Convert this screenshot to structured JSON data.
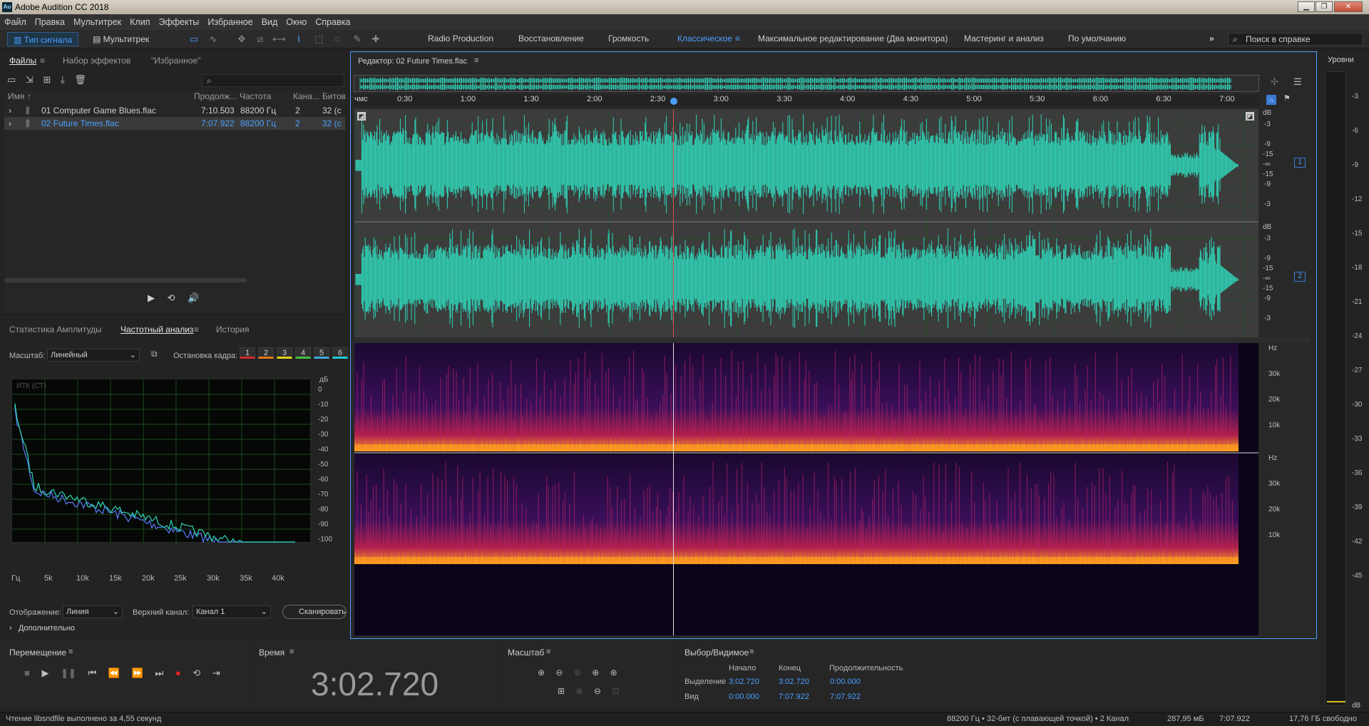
{
  "window": {
    "app_icon": "Au",
    "title": "Adobe Audition CC 2018"
  },
  "menu": [
    "Файл",
    "Правка",
    "Мультитрек",
    "Клип",
    "Эффекты",
    "Избранное",
    "Вид",
    "Окно",
    "Справка"
  ],
  "toolbar": {
    "mode_waveform": "Тип сигнала",
    "mode_multitrack": "Мультитрек",
    "workspaces": [
      "Radio Production",
      "Восстановление",
      "Громкость",
      "Классическое",
      "Максимальное редактирование (Два монитора)",
      "Мастеринг и анализ",
      "По умолчанию"
    ],
    "active_workspace": "Классическое",
    "more": "»",
    "help_search_placeholder": "Поиск в справке"
  },
  "files_panel": {
    "tabs": [
      "Файлы",
      "Набор эффектов",
      "\"Избранное\""
    ],
    "columns": [
      "Имя",
      "Продолж...",
      "Частота",
      "Кана...",
      "Битов"
    ],
    "sort_mark": "↑",
    "files": [
      {
        "name": "01 Computer Game Blues.flac",
        "duration": "7:10.503",
        "rate": "88200 Гц",
        "channels": "2",
        "bits": "32 (с",
        "selected": false
      },
      {
        "name": "02 Future Times.flac",
        "duration": "7:07.922",
        "rate": "88200 Гц",
        "channels": "2",
        "bits": "32 (с",
        "selected": true
      }
    ]
  },
  "analysis_panel": {
    "tabs": [
      "Статистика Амплитуды",
      "Частотный анализ",
      "История"
    ],
    "scale_label": "Масштаб:",
    "scale_value": "Линейный",
    "freeze_label": "Остановка кадра:",
    "freeze_buttons": [
      "1",
      "2",
      "3",
      "4",
      "5",
      "6"
    ],
    "freeze_colors": [
      "#d42a2a",
      "#e07a1a",
      "#e0d21a",
      "#3fbf3f",
      "#3fa8e0",
      "#20c8d8"
    ],
    "graph_label": "ИТК (СТ)",
    "db_unit": "дБ",
    "db_ticks": [
      "0",
      "-10",
      "-20",
      "-30",
      "-40",
      "-50",
      "-60",
      "-70",
      "-80",
      "-90",
      "-100"
    ],
    "freq_ticks": [
      "Гц",
      "5k",
      "10k",
      "15k",
      "20k",
      "25k",
      "30k",
      "35k",
      "40k"
    ],
    "display_label": "Отображение:",
    "display_value": "Линия",
    "channel_label": "Верхний канал:",
    "channel_value": "Канал 1",
    "scan_button": "Сканировать",
    "advanced": "Дополнительно"
  },
  "editor": {
    "title": "Редактор: 02 Future Times.flac",
    "ruler_unit": "чмс",
    "ruler_ticks": [
      "0:30",
      "1:00",
      "1:30",
      "2:00",
      "2:30",
      "3:00",
      "3:30",
      "4:00",
      "4:30",
      "5:00",
      "5:30",
      "6:00",
      "6:30",
      "7:00"
    ],
    "db_labels_top": [
      "dB",
      "-3",
      "-9",
      "-15",
      "-∞",
      "-15",
      "-9",
      "-3"
    ],
    "db_labels_bottom": [
      "dB",
      "-3",
      "-9",
      "-15",
      "-∞",
      "-15",
      "-9",
      "-3"
    ],
    "channel_1": "1",
    "channel_2": "2",
    "hz_labels": [
      "Hz",
      "30k",
      "20k",
      "10k"
    ],
    "wave_color": "#2fd4b8"
  },
  "levels": {
    "title": "Уровни",
    "ticks": [
      "-3",
      "-6",
      "-9",
      "-12",
      "-15",
      "-18",
      "-21",
      "-24",
      "-27",
      "-30",
      "-33",
      "-36",
      "-39",
      "-42",
      "-45",
      "dB"
    ]
  },
  "transport": {
    "title": "Перемещение"
  },
  "time": {
    "title": "Время",
    "value": "3:02.720"
  },
  "zoom": {
    "title": "Масштаб"
  },
  "selection": {
    "title": "Выбор/Видимое",
    "col_start": "Начало",
    "col_end": "Конец",
    "col_duration": "Продолжительность",
    "row_selection": "Выделение",
    "row_view": "Вид",
    "sel_start": "3:02.720",
    "sel_end": "3:02.720",
    "sel_duration": "0:00.000",
    "view_start": "0:00.000",
    "view_end": "7:07.922",
    "view_duration": "7:07.922"
  },
  "status": {
    "left": "Чтение libsndfile выполнено за 4,55 секунд",
    "format": "88200 Гц • 32-бит (с плавающей точкой) • 2 Канал",
    "size": "287,95 мБ",
    "duration": "7:07.922",
    "free": "17,76 ГБ свободно"
  }
}
